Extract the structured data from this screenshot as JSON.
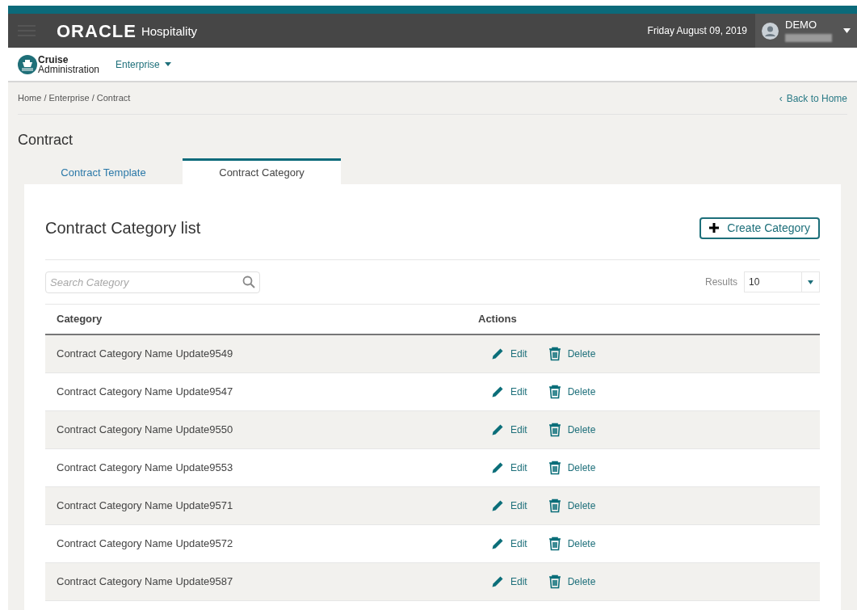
{
  "header": {
    "brand": "ORACLE",
    "product": "Hospitality",
    "date": "Friday August 09, 2019",
    "user": "DEMO"
  },
  "subheader": {
    "app_line1": "Cruise",
    "app_line2": "Administration",
    "menu": "Enterprise"
  },
  "breadcrumb": "Home / Enterprise / Contract",
  "back_link": "Back to Home",
  "back_chevron": "‹",
  "page_title": "Contract",
  "tabs": [
    {
      "label": "Contract Template",
      "selected": false
    },
    {
      "label": "Contract Category",
      "selected": true
    }
  ],
  "panel": {
    "title": "Contract Category list",
    "create_button": "Create Category",
    "search": {
      "placeholder": "Search Category"
    },
    "results_label": "Results",
    "results_value": "10"
  },
  "table": {
    "columns": [
      "Category",
      "Actions"
    ],
    "rows": [
      {
        "name": "Contract Category Name Update9549",
        "edit": "Edit",
        "delete": "Delete"
      },
      {
        "name": "Contract Category Name Update9547",
        "edit": "Edit",
        "delete": "Delete"
      },
      {
        "name": "Contract Category Name Update9550",
        "edit": "Edit",
        "delete": "Delete"
      },
      {
        "name": "Contract Category Name Update9553",
        "edit": "Edit",
        "delete": "Delete"
      },
      {
        "name": "Contract Category Name Update9571",
        "edit": "Edit",
        "delete": "Delete"
      },
      {
        "name": "Contract Category Name Update9572",
        "edit": "Edit",
        "delete": "Delete"
      },
      {
        "name": "Contract Category Name Update9587",
        "edit": "Edit",
        "delete": "Delete"
      }
    ]
  }
}
